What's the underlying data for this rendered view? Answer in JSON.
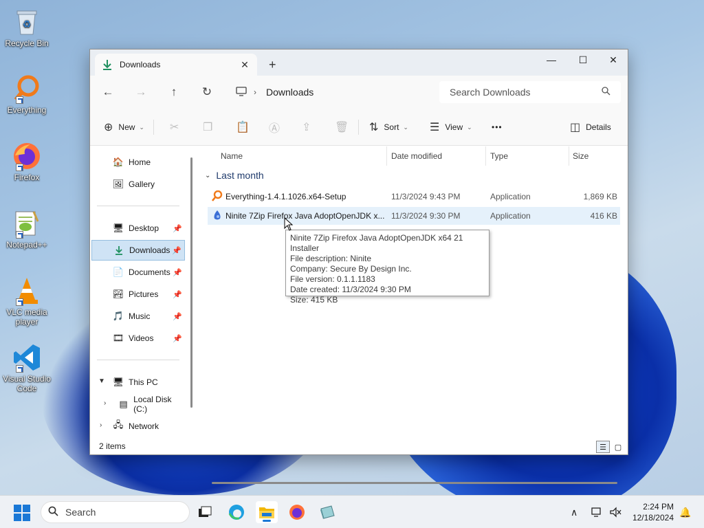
{
  "desktop": {
    "icons": [
      {
        "label": "Recycle Bin"
      },
      {
        "label": "Everything"
      },
      {
        "label": "Firefox"
      },
      {
        "label": "Notepad++"
      },
      {
        "label": "VLC media player"
      },
      {
        "label": "Visual Studio Code"
      }
    ]
  },
  "window": {
    "tab_title": "Downloads",
    "tab_close": "✕",
    "new_tab": "+",
    "minimize": "—",
    "maximize": "☐",
    "close": "✕"
  },
  "address": {
    "back": "←",
    "forward": "→",
    "up": "↑",
    "refresh": "↻",
    "breadcrumb_sep": "›",
    "location": "Downloads",
    "search_placeholder": "Search Downloads"
  },
  "commands": {
    "new": "New",
    "sort": "Sort",
    "view": "View",
    "more": "•••",
    "details": "Details"
  },
  "sidebar": {
    "home": "Home",
    "gallery": "Gallery",
    "desktop": "Desktop",
    "downloads": "Downloads",
    "documents": "Documents",
    "pictures": "Pictures",
    "music": "Music",
    "videos": "Videos",
    "this_pc": "This PC",
    "local_disk": "Local Disk (C:)",
    "network": "Network"
  },
  "columns": {
    "name": "Name",
    "date": "Date modified",
    "type": "Type",
    "size": "Size"
  },
  "group_label": "Last month",
  "files": [
    {
      "name": "Everything-1.4.1.1026.x64-Setup",
      "date": "11/3/2024 9:43 PM",
      "type": "Application",
      "size": "1,869 KB"
    },
    {
      "name": "Ninite 7Zip Firefox Java AdoptOpenJDK x...",
      "date": "11/3/2024 9:30 PM",
      "type": "Application",
      "size": "416 KB"
    }
  ],
  "tooltip": {
    "line1": "Ninite 7Zip Firefox Java AdoptOpenJDK x64 21 Installer",
    "line2": "File description: Ninite",
    "line3": "Company: Secure By Design Inc.",
    "line4": "File version: 0.1.1.1183",
    "line5": "Date created: 11/3/2024 9:30 PM",
    "line6": "Size: 415 KB"
  },
  "status": {
    "count": "2 items"
  },
  "taskbar": {
    "search_label": "Search",
    "time": "2:24 PM",
    "date": "12/18/2024"
  }
}
